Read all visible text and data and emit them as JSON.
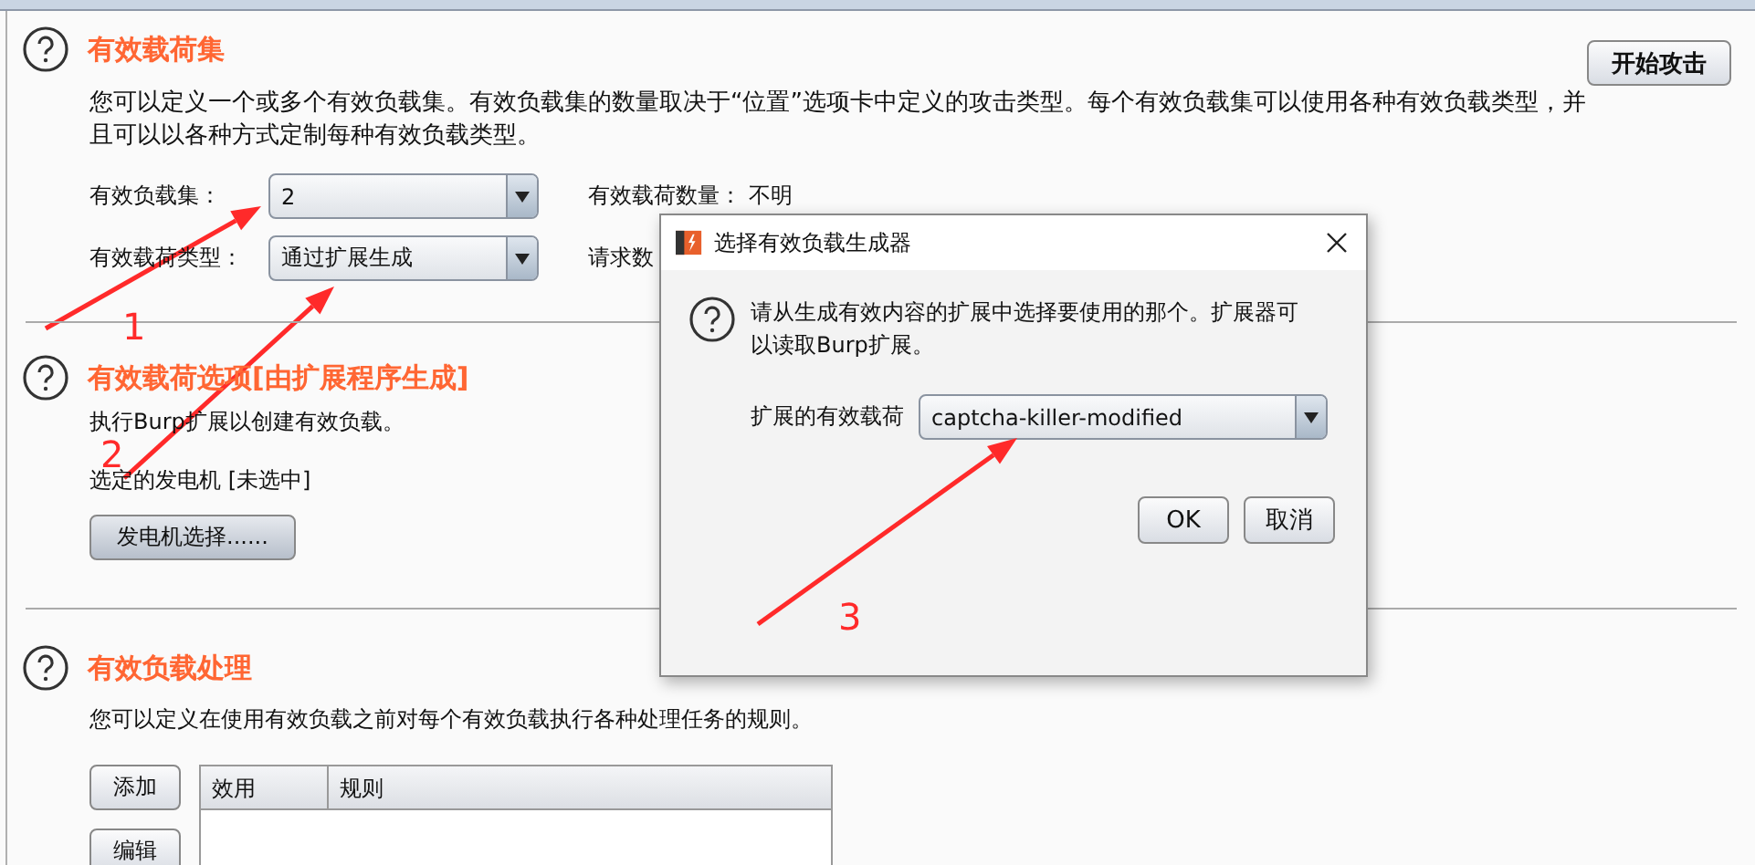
{
  "attack_button": "开始攻击",
  "payload_sets": {
    "title": "有效载荷集",
    "description": "您可以定义一个或多个有效负载集。有效负载集的数量取决于“位置”选项卡中定义的攻击类型。每个有效负载集可以使用各种有效负载类型，并且可以以各种方式定制每种有效负载类型。",
    "set_label": "有效负载集：",
    "set_value": "2",
    "type_label": "有效载荷类型：",
    "type_value": "通过扩展生成",
    "count_label": "有效载荷数量：",
    "count_value": "不明",
    "request_label": "请求数"
  },
  "payload_options": {
    "title": "有效载荷选项[由扩展程序生成]",
    "description": "执行Burp扩展以创建有效负载。",
    "generator_label": "选定的发电机",
    "generator_value": "[未选中]",
    "select_button": "发电机选择......"
  },
  "payload_processing": {
    "title": "有效负载处理",
    "description": "您可以定义在使用有效负载之前对每个有效负载执行各种处理任务的规则。",
    "buttons": [
      "添加",
      "编辑"
    ],
    "columns": [
      "效用",
      "规则"
    ]
  },
  "dialog": {
    "title": "选择有效负载生成器",
    "message": "请从生成有效内容的扩展中选择要使用的那个。扩展器可以读取Burp扩展。",
    "field_label": "扩展的有效载荷",
    "field_value": "captcha-killer-modified",
    "buttons": [
      "OK",
      "取消"
    ]
  },
  "annotations": [
    {
      "label": "1"
    },
    {
      "label": "2"
    },
    {
      "label": "3"
    }
  ]
}
